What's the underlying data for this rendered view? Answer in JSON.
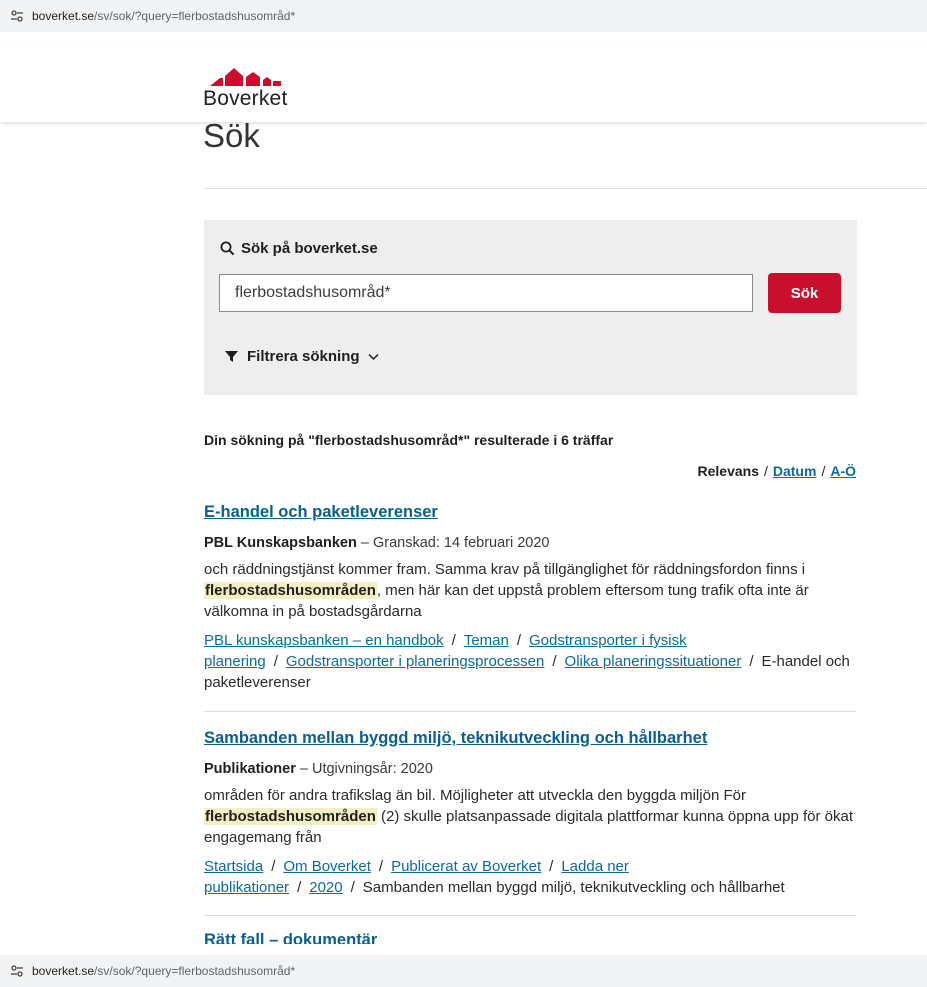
{
  "browser": {
    "url_domain": "boverket.se",
    "url_path": "/sv/sok/?query=flerbostadshusområd*"
  },
  "header": {
    "logo_text": "Boverket",
    "brand_color": "#c8102e"
  },
  "page": {
    "title": "Sök"
  },
  "search": {
    "label": "Sök på boverket.se",
    "value": "flerbostadshusområd*",
    "button": "Sök",
    "filter_label": "Filtrera sökning"
  },
  "summary": "Din sökning på \"flerbostadshusområd*\" resulterade i 6 träffar",
  "sort": {
    "relevance": "Relevans",
    "date": "Datum",
    "az": "A-Ö",
    "separator": "/"
  },
  "results": [
    {
      "title": "E-handel och paketleverenser",
      "category": "PBL Kunskapsbanken",
      "meta_rest": " – Granskad: 14 februari 2020",
      "snippet_before": "och räddningstjänst kommer fram. Samma krav på tillgänglighet för räddningsfordon finns i ",
      "snippet_highlight": "flerbostadshusområden",
      "snippet_after": ", men här kan det uppstå problem eftersom tung trafik ofta inte är välkomna in på bostadsgårdarna",
      "crumbs": [
        "PBL kunskapsbanken – en handbok",
        "Teman",
        "Godstransporter i fysisk planering",
        "Godstransporter i planeringsprocessen",
        "Olika planeringssituationer"
      ],
      "current": "E-handel och paketleverenser"
    },
    {
      "title": "Sambanden mellan byggd miljö, teknikutveckling och hållbarhet",
      "category": "Publikationer",
      "meta_rest": " – Utgivningsår: 2020",
      "snippet_before": "områden för andra trafikslag än bil. Möjligheter att utveckla den byggda miljön För ",
      "snippet_highlight": "flerbostadshusområden",
      "snippet_after": " (2) skulle platsanpassade digitala plattformar kunna öppna upp för ökat engagemang från",
      "crumbs": [
        "Startsida",
        "Om Boverket",
        "Publicerat av Boverket",
        "Ladda ner publikationer",
        "2020"
      ],
      "current": "Sambanden mellan byggd miljö, teknikutveckling och hållbarhet"
    }
  ],
  "partial_result_title": "Rätt fall – dokumentär"
}
